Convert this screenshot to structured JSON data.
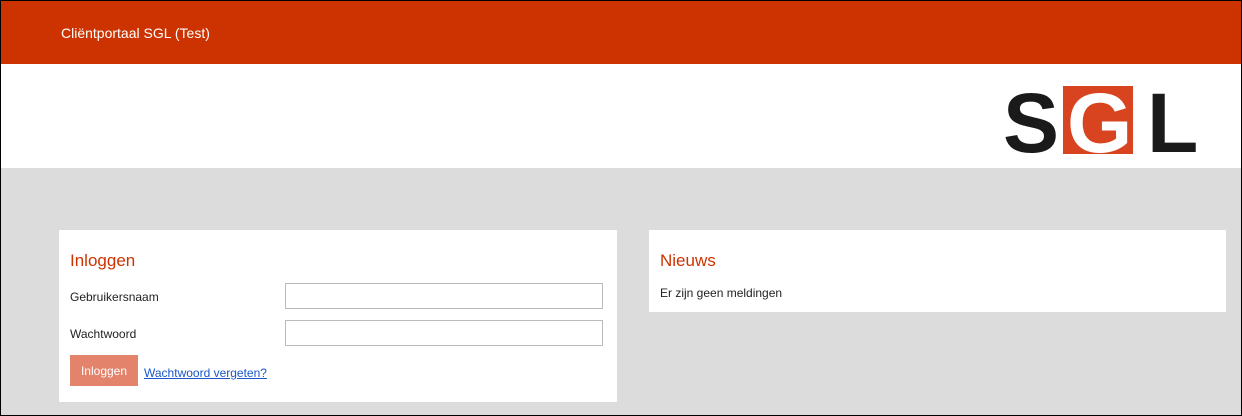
{
  "app": {
    "title": "Cliëntportaal SGL (Test)"
  },
  "logo": {
    "text": "SGL",
    "icon": "sgl-logo"
  },
  "login": {
    "heading": "Inloggen",
    "username_label": "Gebruikersnaam",
    "username_value": "",
    "password_label": "Wachtwoord",
    "password_value": "",
    "submit_label": "Inloggen",
    "forgot_label": "Wachtwoord vergeten?"
  },
  "news": {
    "heading": "Nieuws",
    "message": "Er zijn geen meldingen"
  },
  "colors": {
    "brand": "#cc3300",
    "background": "#dcdcdc",
    "button": "#e3836b",
    "link": "#1a56c8"
  }
}
